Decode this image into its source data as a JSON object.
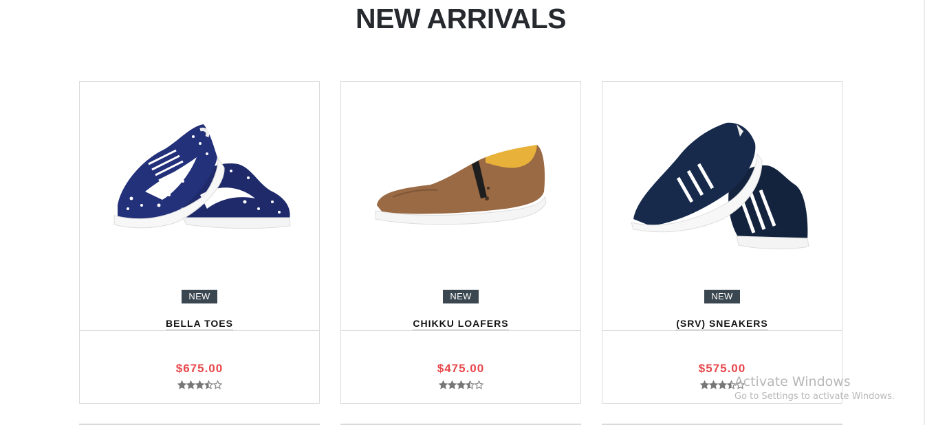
{
  "section": {
    "title": "NEW ARRIVALS"
  },
  "accent": {
    "price_color": "#e8474b",
    "badge_color": "#3b4750"
  },
  "products": [
    {
      "badge": "NEW",
      "name": "BELLA TOES",
      "price": "$675.00",
      "rating": 3.5,
      "rating_max": 5,
      "image": "blue-star-canvas-sneakers"
    },
    {
      "badge": "NEW",
      "name": "CHIKKU LOAFERS",
      "price": "$475.00",
      "rating": 3.5,
      "rating_max": 5,
      "image": "brown-slip-on-loafer"
    },
    {
      "badge": "NEW",
      "name": "(SRV) SNEAKERS",
      "price": "$575.00",
      "rating": 3.5,
      "rating_max": 5,
      "image": "navy-striped-sneakers"
    }
  ],
  "watermark": {
    "title": "Activate Windows",
    "subtitle": "Go to Settings to activate Windows."
  }
}
